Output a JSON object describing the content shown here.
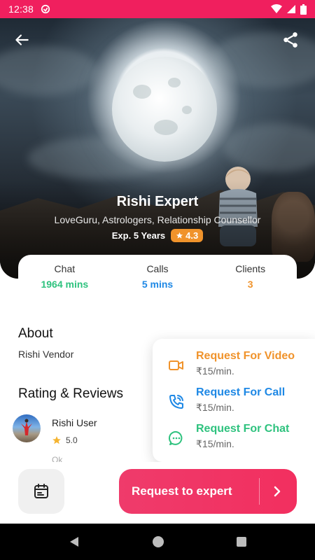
{
  "status_bar": {
    "time": "12:38",
    "icons": [
      "app-notification-icon",
      "wifi-icon",
      "signal-icon",
      "battery-icon"
    ]
  },
  "profile": {
    "name": "Rishi Expert",
    "tags": "LoveGuru, Astrologers, Relationship Counsellor",
    "experience": "Exp. 5 Years",
    "rating": "4.3"
  },
  "stats": [
    {
      "label": "Chat",
      "value": "1964 mins",
      "color": "#2ec27e"
    },
    {
      "label": "Calls",
      "value": "5 mins",
      "color": "#1e88e5"
    },
    {
      "label": "Clients",
      "value": "3",
      "color": "#f0932b"
    }
  ],
  "about": {
    "title": "About",
    "text": "Rishi Vendor"
  },
  "reviews_section": {
    "title": "Rating & Reviews",
    "reviews": [
      {
        "name": "Rishi User",
        "rating": "5.0"
      }
    ],
    "partial_text": "Ok"
  },
  "request_menu": [
    {
      "title": "Request For Video",
      "price": "₹15/min.",
      "color": "#f0932b",
      "icon": "video-camera-icon"
    },
    {
      "title": "Request For Call",
      "price": "₹15/min.",
      "color": "#1e88e5",
      "icon": "phone-call-icon"
    },
    {
      "title": "Request For Chat",
      "price": "₹15/min.",
      "color": "#2ec27e",
      "icon": "chat-icon"
    }
  ],
  "bottom_bar": {
    "cta_label": "Request to expert",
    "calendar_icon": "calendar-icon"
  },
  "colors": {
    "accent": "#f01f5e",
    "status_bar": "#f01f5e",
    "cta": "#ef3b6b"
  }
}
